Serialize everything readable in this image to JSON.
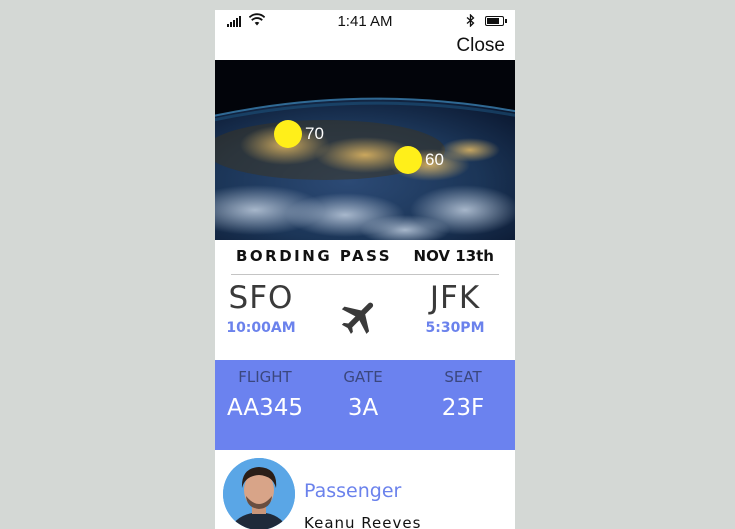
{
  "status_bar": {
    "time": "1:41 AM"
  },
  "header": {
    "close_label": "Close"
  },
  "map": {
    "markers": [
      {
        "value": "70"
      },
      {
        "value": "60"
      }
    ]
  },
  "pass": {
    "title": "BORDING PASS",
    "date": "NOV 13th",
    "origin": {
      "code": "SFO",
      "time": "10:00AM"
    },
    "destination": {
      "code": "JFK",
      "time": "5:30PM"
    },
    "details": [
      {
        "label": "FLIGHT",
        "value": "AA345"
      },
      {
        "label": "GATE",
        "value": "3A"
      },
      {
        "label": "SEAT",
        "value": "23F"
      }
    ]
  },
  "passenger": {
    "label": "Passenger",
    "name": "Keanu Reeves"
  },
  "colors": {
    "accent": "#6b82ef",
    "marker": "#ffef1a",
    "background": "#d4d8d5"
  }
}
